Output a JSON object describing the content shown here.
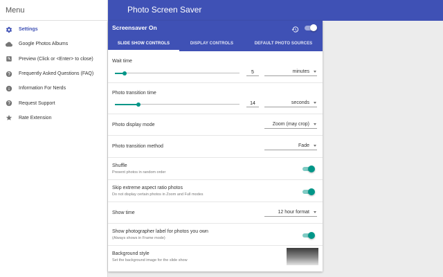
{
  "app": {
    "title": "Photo Screen Saver"
  },
  "sidebar": {
    "header": "Menu",
    "items": [
      {
        "label": "Settings",
        "icon": "gear-icon"
      },
      {
        "label": "Google Photos Albums",
        "icon": "cloud-icon"
      },
      {
        "label": "Preview (Click or <Enter> to close)",
        "icon": "preview-icon"
      },
      {
        "label": "Frequently Asked Questions (FAQ)",
        "icon": "help-icon"
      },
      {
        "label": "Information For Nerds",
        "icon": "info-icon"
      },
      {
        "label": "Request Support",
        "icon": "help-icon"
      },
      {
        "label": "Rate Extension",
        "icon": "star-icon"
      }
    ]
  },
  "card": {
    "title": "Screensaver On",
    "enabled": true,
    "tabs": [
      {
        "label": "SLIDE SHOW CONTROLS",
        "active": true
      },
      {
        "label": "DISPLAY CONTROLS",
        "active": false
      },
      {
        "label": "DEFAULT PHOTO SOURCES",
        "active": false
      }
    ]
  },
  "settings": {
    "wait_time": {
      "label": "Wait time",
      "value": "5",
      "unit": "minutes",
      "slider_fraction": 0.08
    },
    "transition_time": {
      "label": "Photo transition time",
      "value": "14",
      "unit": "seconds",
      "slider_fraction": 0.19
    },
    "display_mode": {
      "label": "Photo display mode",
      "value": "Zoom (may crop)"
    },
    "transition_method": {
      "label": "Photo transition method",
      "value": "Fade"
    },
    "shuffle": {
      "label": "Shuffle",
      "sublabel": "Present photos in random order",
      "on": true
    },
    "skip_aspect": {
      "label": "Skip extreme aspect ratio photos",
      "sublabel": "Do not display certain photos in Zoom and Full modes",
      "on": true
    },
    "show_time": {
      "label": "Show time",
      "value": "12 hour format"
    },
    "photographer_label": {
      "label": "Show photographer label for photos you own",
      "sublabel": "(Always shows in Frame mode)",
      "on": true
    },
    "background_style": {
      "label": "Background style",
      "sublabel": "Set the background image for the slide show"
    }
  },
  "colors": {
    "primary": "#3f51b5",
    "accent": "#009688"
  }
}
